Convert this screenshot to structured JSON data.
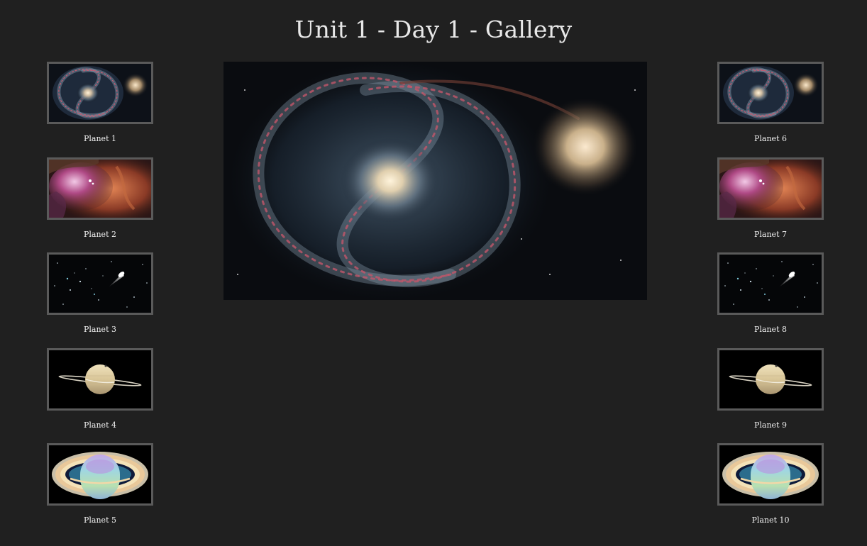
{
  "page": {
    "title": "Unit 1 - Day 1 - Gallery"
  },
  "main_image": {
    "subject": "whirlpool-galaxy"
  },
  "left_gallery": [
    {
      "label": "Planet 1",
      "image": "whirlpool-galaxy"
    },
    {
      "label": "Planet 2",
      "image": "orion-nebula"
    },
    {
      "label": "Planet 3",
      "image": "comet-starfield"
    },
    {
      "label": "Planet 4",
      "image": "saturn-edge-on"
    },
    {
      "label": "Planet 5",
      "image": "saturn-ultraviolet"
    }
  ],
  "right_gallery": [
    {
      "label": "Planet 6",
      "image": "whirlpool-galaxy"
    },
    {
      "label": "Planet 7",
      "image": "orion-nebula"
    },
    {
      "label": "Planet 8",
      "image": "comet-starfield"
    },
    {
      "label": "Planet 9",
      "image": "saturn-edge-on"
    },
    {
      "label": "Planet 10",
      "image": "saturn-ultraviolet"
    }
  ],
  "colors": {
    "background": "#202020",
    "thumb_border": "#5a5a5a",
    "text": "#f0f0f0"
  }
}
